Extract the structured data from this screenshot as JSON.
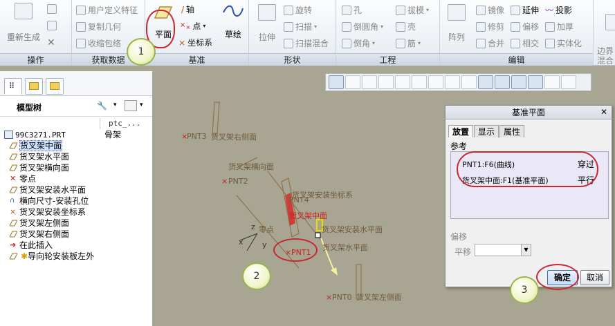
{
  "ribbon": {
    "regen_label": "重新生成",
    "groups": {
      "operation": "操作",
      "get_data": "获取数据",
      "datum": "基准",
      "shape": "形状",
      "engineering": "工程",
      "edit": "编辑"
    },
    "get_data_items": [
      "用户定义特征",
      "复制几何",
      "收缩包络"
    ],
    "datum_items": {
      "plane": "平面",
      "axis": "轴",
      "point": "点",
      "csys": "坐标系",
      "sketch": "草绘"
    },
    "shape_items": [
      "拉伸",
      "旋转",
      "扫描",
      "扫描混合"
    ],
    "eng_items": [
      "孔",
      "倒圆角",
      "倒角",
      "拔模",
      "壳",
      "筋"
    ],
    "edit_items": [
      "阵列",
      "镜像",
      "修剪",
      "合并",
      "延伸",
      "偏移",
      "相交",
      "投影",
      "加厚",
      "实体化"
    ],
    "extra": "边界\n混合"
  },
  "markers": [
    "1",
    "2",
    "3"
  ],
  "model_tree": {
    "title": "模型树",
    "col1": "",
    "col2": "ptc_...",
    "root": {
      "name": "99C3271.PRT",
      "type": "骨架"
    },
    "items": [
      "货叉架中面",
      "货叉架水平面",
      "货叉架横向面",
      "零点",
      "货叉架安装水平面",
      "横向尺寸-安装孔位",
      "货叉架安装坐标系",
      "货叉架左侧面",
      "货叉架右侧面",
      "在此插入",
      "导向轮安装板左外"
    ]
  },
  "canvas_labels": {
    "pnt3": "PNT3",
    "right_side": "货叉架右侧面",
    "lateral": "货叉架横向面",
    "pnt2": "PNT2",
    "csys": "货叉架安装坐标系",
    "pnt4": "PNT4",
    "mid": "货叉架中面",
    "zero": "零点",
    "mount_h": "货叉架安装水平面",
    "horizontal": "货叉架水平面",
    "pnt1": "PNT1",
    "pnt0": "PNT0",
    "left_side": "货叉架左侧面",
    "z": "z",
    "x": "x",
    "y": "y"
  },
  "dialog": {
    "title": "基准平面",
    "tabs": [
      "放置",
      "显示",
      "属性"
    ],
    "ref_label": "参考",
    "refs": [
      {
        "name": "PNT1:F6(曲线)",
        "rel": "穿过"
      },
      {
        "name": "货叉架中面:F1(基准平面)",
        "rel": "平行"
      }
    ],
    "offset_label": "偏移",
    "translate_label": "平移",
    "ok": "确定",
    "cancel": "取消"
  }
}
